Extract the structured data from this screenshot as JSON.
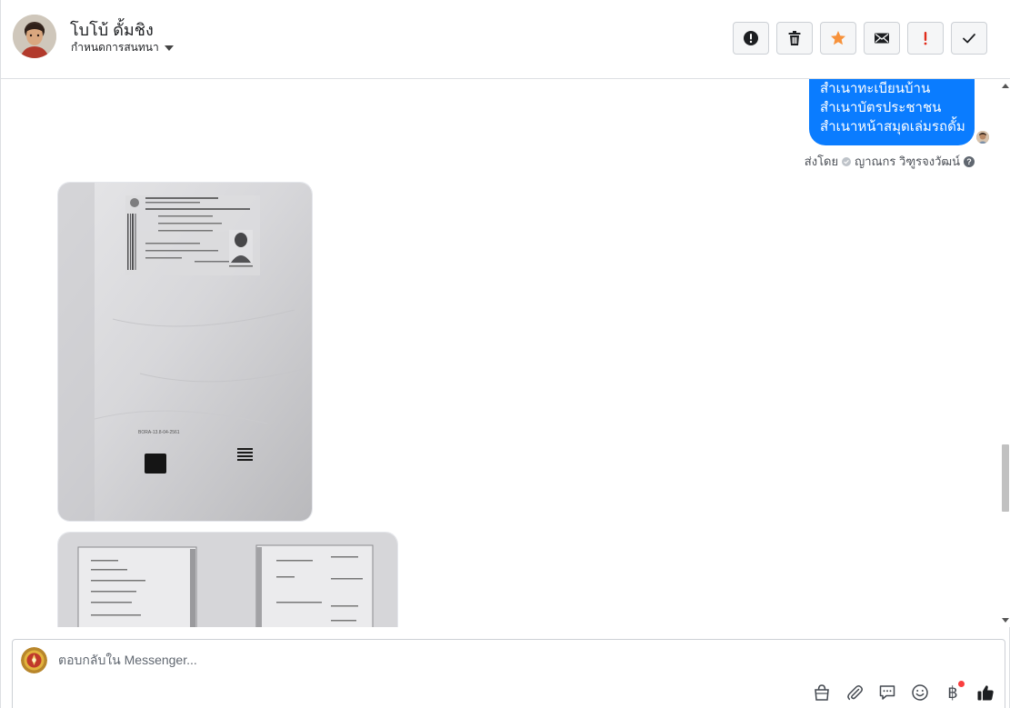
{
  "header": {
    "contact_name": "โบโบ้ ดั้มชิง",
    "assign_label": "กำหนดการสนทนา"
  },
  "actions": [
    {
      "name": "mark-spam-button",
      "icon": "alert-circle-icon"
    },
    {
      "name": "delete-button",
      "icon": "trash-icon"
    },
    {
      "name": "star-button",
      "icon": "star-icon",
      "color": "#f7923b"
    },
    {
      "name": "mark-unread-button",
      "icon": "envelope-icon"
    },
    {
      "name": "follow-up-button",
      "icon": "exclamation-icon",
      "color": "#e02c1b"
    },
    {
      "name": "mark-done-button",
      "icon": "check-icon"
    }
  ],
  "thread": {
    "message_lines": [
      "สำเนาทะเบียนบ้าน",
      "สำเนาบัตรประชาชน",
      "สำเนาหน้าสมุดเล่มรถดั้ม"
    ],
    "sent_by_prefix": "ส่งโดย",
    "sender_name": "ญาณกร วิฑูรจงวัฒน์",
    "photo_captions": [
      "BORA-13.8-04-2561"
    ]
  },
  "composer": {
    "placeholder": "ตอบกลับใน Messenger...",
    "tools": [
      "shop-bag-icon",
      "paperclip-icon",
      "saved-reply-icon",
      "emoji-icon",
      "baht-payment-icon",
      "thumbs-up-icon"
    ],
    "baht_symbol": "฿"
  },
  "colors": {
    "bubble": "#0a7cff",
    "star": "#f7923b",
    "follow_up": "#e02c1b",
    "notification_dot": "#fa3e3e"
  }
}
